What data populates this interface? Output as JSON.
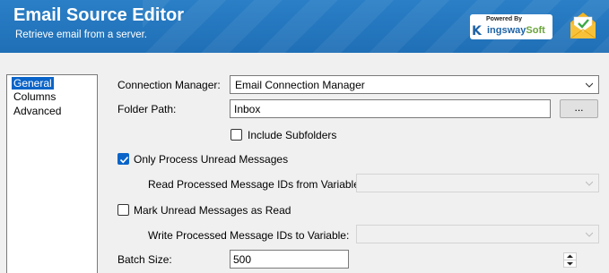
{
  "header": {
    "title": "Email Source Editor",
    "subtitle": "Retrieve email from a server.",
    "logo_powered": "Powered By",
    "logo_k": "K",
    "logo_brand_a": "ingsway",
    "logo_brand_b": "Soft"
  },
  "sidebar": {
    "items": [
      {
        "label": "General",
        "selected": true
      },
      {
        "label": "Columns",
        "selected": false
      },
      {
        "label": "Advanced",
        "selected": false
      }
    ]
  },
  "form": {
    "connection_manager": {
      "label": "Connection Manager:",
      "value": "Email Connection Manager"
    },
    "folder_path": {
      "label": "Folder Path:",
      "value": "Inbox",
      "browse_label": "..."
    },
    "include_subfolders": {
      "label": "Include Subfolders",
      "checked": false
    },
    "only_unread": {
      "label": "Only Process Unread Messages",
      "checked": true
    },
    "read_processed_ids": {
      "label": "Read Processed Message IDs from Variable:",
      "value": ""
    },
    "mark_unread_read": {
      "label": "Mark Unread Messages as Read",
      "checked": false
    },
    "write_processed_ids": {
      "label": "Write Processed Message IDs to Variable:",
      "value": ""
    },
    "batch_size": {
      "label": "Batch Size:",
      "value": "500"
    }
  },
  "colors": {
    "header_blue": "#1f6fb6",
    "selection_blue": "#0a64c8"
  }
}
